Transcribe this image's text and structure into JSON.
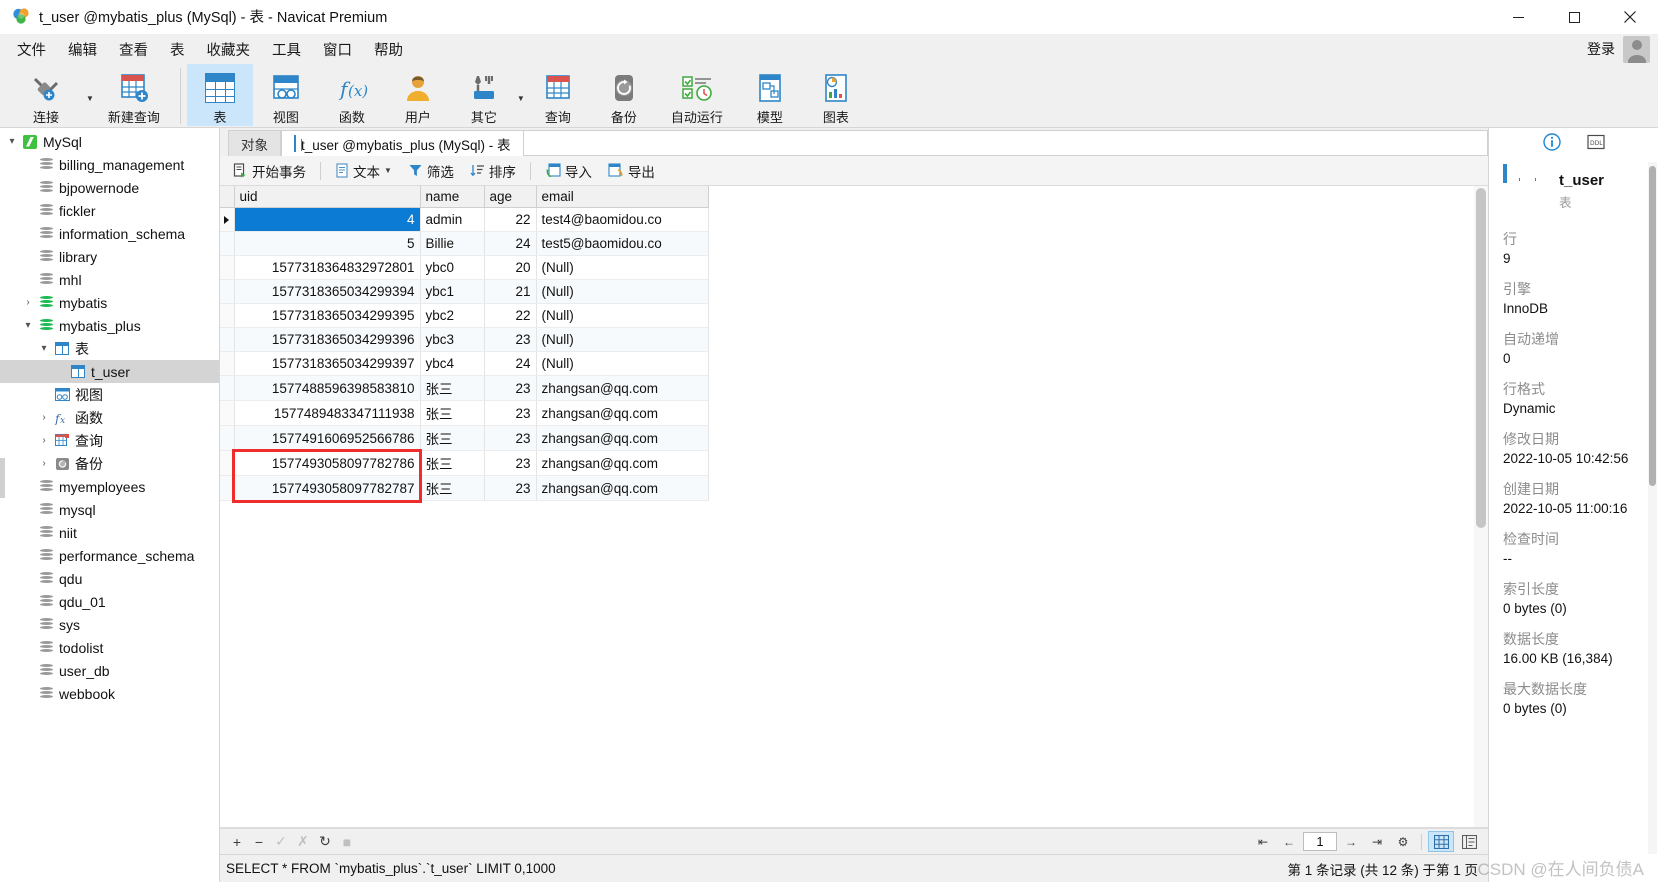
{
  "window": {
    "title": "t_user @mybatis_plus (MySql) - 表 - Navicat Premium",
    "logo_icon": "navicat-logo-icon",
    "minimize_label": "—",
    "maximize_label": "□",
    "close_label": "✕"
  },
  "menubar": {
    "items": [
      {
        "label": "文件",
        "name": "menu-file"
      },
      {
        "label": "编辑",
        "name": "menu-edit"
      },
      {
        "label": "查看",
        "name": "menu-view"
      },
      {
        "label": "表",
        "name": "menu-table"
      },
      {
        "label": "收藏夹",
        "name": "menu-favorites"
      },
      {
        "label": "工具",
        "name": "menu-tools"
      },
      {
        "label": "窗口",
        "name": "menu-window"
      },
      {
        "label": "帮助",
        "name": "menu-help"
      }
    ],
    "login_label": "登录"
  },
  "ribbon": {
    "buttons": [
      {
        "label": "连接",
        "icon": "connection-icon",
        "name": "ribbon-connection",
        "active": false,
        "caret": true
      },
      {
        "label": "新建查询",
        "icon": "new-query-icon",
        "name": "ribbon-new-query",
        "active": false,
        "caret": false
      },
      {
        "label": "表",
        "icon": "table-icon",
        "name": "ribbon-table",
        "active": true,
        "caret": false
      },
      {
        "label": "视图",
        "icon": "view-icon",
        "name": "ribbon-view",
        "active": false,
        "caret": false
      },
      {
        "label": "函数",
        "icon": "function-icon",
        "name": "ribbon-function",
        "active": false,
        "caret": false
      },
      {
        "label": "用户",
        "icon": "user-icon",
        "name": "ribbon-user",
        "active": false,
        "caret": false
      },
      {
        "label": "其它",
        "icon": "other-tools-icon",
        "name": "ribbon-other",
        "active": false,
        "caret": true
      },
      {
        "label": "查询",
        "icon": "query-icon",
        "name": "ribbon-query",
        "active": false,
        "caret": false
      },
      {
        "label": "备份",
        "icon": "backup-icon",
        "name": "ribbon-backup",
        "active": false,
        "caret": false
      },
      {
        "label": "自动运行",
        "icon": "automation-icon",
        "name": "ribbon-automation",
        "active": false,
        "caret": false
      },
      {
        "label": "模型",
        "icon": "model-icon",
        "name": "ribbon-model",
        "active": false,
        "caret": false
      },
      {
        "label": "图表",
        "icon": "chart-icon",
        "name": "ribbon-chart",
        "active": false,
        "caret": false
      }
    ]
  },
  "sidebar": {
    "items": [
      {
        "label": "MySql",
        "indent": 0,
        "twisty": "▾",
        "icon": "mysql-server-icon",
        "selected": false
      },
      {
        "label": "billing_management",
        "indent": 1,
        "twisty": "",
        "icon": "database-icon",
        "selected": false
      },
      {
        "label": "bjpowernode",
        "indent": 1,
        "twisty": "",
        "icon": "database-icon",
        "selected": false
      },
      {
        "label": "fickler",
        "indent": 1,
        "twisty": "",
        "icon": "database-icon",
        "selected": false
      },
      {
        "label": "information_schema",
        "indent": 1,
        "twisty": "",
        "icon": "database-icon",
        "selected": false
      },
      {
        "label": "library",
        "indent": 1,
        "twisty": "",
        "icon": "database-icon",
        "selected": false
      },
      {
        "label": "mhl",
        "indent": 1,
        "twisty": "",
        "icon": "database-icon",
        "selected": false
      },
      {
        "label": "mybatis",
        "indent": 1,
        "twisty": "›",
        "icon": "database-open-icon",
        "selected": false
      },
      {
        "label": "mybatis_plus",
        "indent": 1,
        "twisty": "▾",
        "icon": "database-open-icon",
        "selected": false
      },
      {
        "label": "表",
        "indent": 2,
        "twisty": "▾",
        "icon": "table-folder-icon",
        "selected": false
      },
      {
        "label": "t_user",
        "indent": 3,
        "twisty": "",
        "icon": "table-icon",
        "selected": true
      },
      {
        "label": "视图",
        "indent": 2,
        "twisty": "",
        "icon": "view-folder-icon",
        "selected": false
      },
      {
        "label": "函数",
        "indent": 2,
        "twisty": "›",
        "icon": "function-folder-icon",
        "selected": false
      },
      {
        "label": "查询",
        "indent": 2,
        "twisty": "›",
        "icon": "query-folder-icon",
        "selected": false
      },
      {
        "label": "备份",
        "indent": 2,
        "twisty": "›",
        "icon": "backup-folder-icon",
        "selected": false
      },
      {
        "label": "myemployees",
        "indent": 1,
        "twisty": "",
        "icon": "database-icon",
        "selected": false
      },
      {
        "label": "mysql",
        "indent": 1,
        "twisty": "",
        "icon": "database-icon",
        "selected": false
      },
      {
        "label": "niit",
        "indent": 1,
        "twisty": "",
        "icon": "database-icon",
        "selected": false
      },
      {
        "label": "performance_schema",
        "indent": 1,
        "twisty": "",
        "icon": "database-icon",
        "selected": false
      },
      {
        "label": "qdu",
        "indent": 1,
        "twisty": "",
        "icon": "database-icon",
        "selected": false
      },
      {
        "label": "qdu_01",
        "indent": 1,
        "twisty": "",
        "icon": "database-icon",
        "selected": false
      },
      {
        "label": "sys",
        "indent": 1,
        "twisty": "",
        "icon": "database-icon",
        "selected": false
      },
      {
        "label": "todolist",
        "indent": 1,
        "twisty": "",
        "icon": "database-icon",
        "selected": false
      },
      {
        "label": "user_db",
        "indent": 1,
        "twisty": "",
        "icon": "database-icon",
        "selected": false
      },
      {
        "label": "webbook",
        "indent": 1,
        "twisty": "",
        "icon": "database-icon",
        "selected": false
      }
    ]
  },
  "tabs": {
    "objects_label": "对象",
    "active_label": "t_user @mybatis_plus (MySql) - 表"
  },
  "grid_toolbar": {
    "buttons": [
      {
        "label": "开始事务",
        "icon": "transaction-icon",
        "name": "begin-transaction-button",
        "caret": false
      },
      {
        "label": "文本",
        "icon": "text-icon",
        "name": "text-button",
        "caret": true
      },
      {
        "label": "筛选",
        "icon": "filter-icon",
        "name": "filter-button",
        "caret": false
      },
      {
        "label": "排序",
        "icon": "sort-icon",
        "name": "sort-button",
        "caret": false
      },
      {
        "label": "导入",
        "icon": "import-icon",
        "name": "import-button",
        "caret": false
      },
      {
        "label": "导出",
        "icon": "export-icon",
        "name": "export-button",
        "caret": false
      }
    ]
  },
  "datagrid": {
    "columns": [
      "uid",
      "name",
      "age",
      "email"
    ],
    "rows": [
      {
        "uid": "4",
        "name": "admin",
        "age": "22",
        "email": "test4@baomidou.co",
        "selected": true,
        "null_email": false
      },
      {
        "uid": "5",
        "name": "Billie",
        "age": "24",
        "email": "test5@baomidou.co",
        "selected": false,
        "null_email": false
      },
      {
        "uid": "1577318364832972801",
        "name": "ybc0",
        "age": "20",
        "email": "(Null)",
        "selected": false,
        "null_email": true
      },
      {
        "uid": "1577318365034299394",
        "name": "ybc1",
        "age": "21",
        "email": "(Null)",
        "selected": false,
        "null_email": true
      },
      {
        "uid": "1577318365034299395",
        "name": "ybc2",
        "age": "22",
        "email": "(Null)",
        "selected": false,
        "null_email": true
      },
      {
        "uid": "1577318365034299396",
        "name": "ybc3",
        "age": "23",
        "email": "(Null)",
        "selected": false,
        "null_email": true
      },
      {
        "uid": "1577318365034299397",
        "name": "ybc4",
        "age": "24",
        "email": "(Null)",
        "selected": false,
        "null_email": true
      },
      {
        "uid": "1577488596398583810",
        "name": "张三",
        "age": "23",
        "email": "zhangsan@qq.com",
        "selected": false,
        "null_email": false
      },
      {
        "uid": "1577489483347111938",
        "name": "张三",
        "age": "23",
        "email": "zhangsan@qq.com",
        "selected": false,
        "null_email": false
      },
      {
        "uid": "1577491606952566786",
        "name": "张三",
        "age": "23",
        "email": "zhangsan@qq.com",
        "selected": false,
        "null_email": false
      },
      {
        "uid": "1577493058097782786",
        "name": "张三",
        "age": "23",
        "email": "zhangsan@qq.com",
        "selected": false,
        "null_email": false
      },
      {
        "uid": "1577493058097782787",
        "name": "张三",
        "age": "23",
        "email": "zhangsan@qq.com",
        "selected": false,
        "null_email": false
      }
    ],
    "highlight_color": "#ef2c2c"
  },
  "grid_bottom": {
    "icons": [
      {
        "glyph": "+",
        "name": "add-record-button",
        "dim": false
      },
      {
        "glyph": "−",
        "name": "delete-record-button",
        "dim": false
      },
      {
        "glyph": "✓",
        "name": "apply-changes-button",
        "dim": true
      },
      {
        "glyph": "✗",
        "name": "cancel-changes-button",
        "dim": true
      },
      {
        "glyph": "↻",
        "name": "refresh-button",
        "dim": false
      },
      {
        "glyph": "■",
        "name": "stop-button",
        "dim": true
      }
    ],
    "pager": {
      "first": "⇤",
      "prev": "←",
      "page_value": "1",
      "next": "→",
      "last": "⇥",
      "settings": "⚙"
    },
    "view_grid_icon": "grid-view-icon",
    "view_form_icon": "form-view-icon"
  },
  "statusbar": {
    "sql": "SELECT * FROM `mybatis_plus`.`t_user` LIMIT 0,1000",
    "record_info": "第 1 条记录 (共 12 条) 于第 1 页"
  },
  "infopanel": {
    "tab_info_icon": "info-icon",
    "tab_ddl_icon": "ddl-icon",
    "table_name": "t_user",
    "table_type": "表",
    "fields": [
      {
        "key": "行",
        "value": "9"
      },
      {
        "key": "引擎",
        "value": "InnoDB"
      },
      {
        "key": "自动递增",
        "value": "0"
      },
      {
        "key": "行格式",
        "value": "Dynamic"
      },
      {
        "key": "修改日期",
        "value": "2022-10-05 10:42:56"
      },
      {
        "key": "创建日期",
        "value": "2022-10-05 11:00:16"
      },
      {
        "key": "检查时间",
        "value": "--"
      },
      {
        "key": "索引长度",
        "value": "0 bytes (0)"
      },
      {
        "key": "数据长度",
        "value": "16.00 KB (16,384)"
      },
      {
        "key": "最大数据长度",
        "value": "0 bytes (0)"
      }
    ]
  },
  "watermark": {
    "text": "CSDN @在人间负债A"
  }
}
